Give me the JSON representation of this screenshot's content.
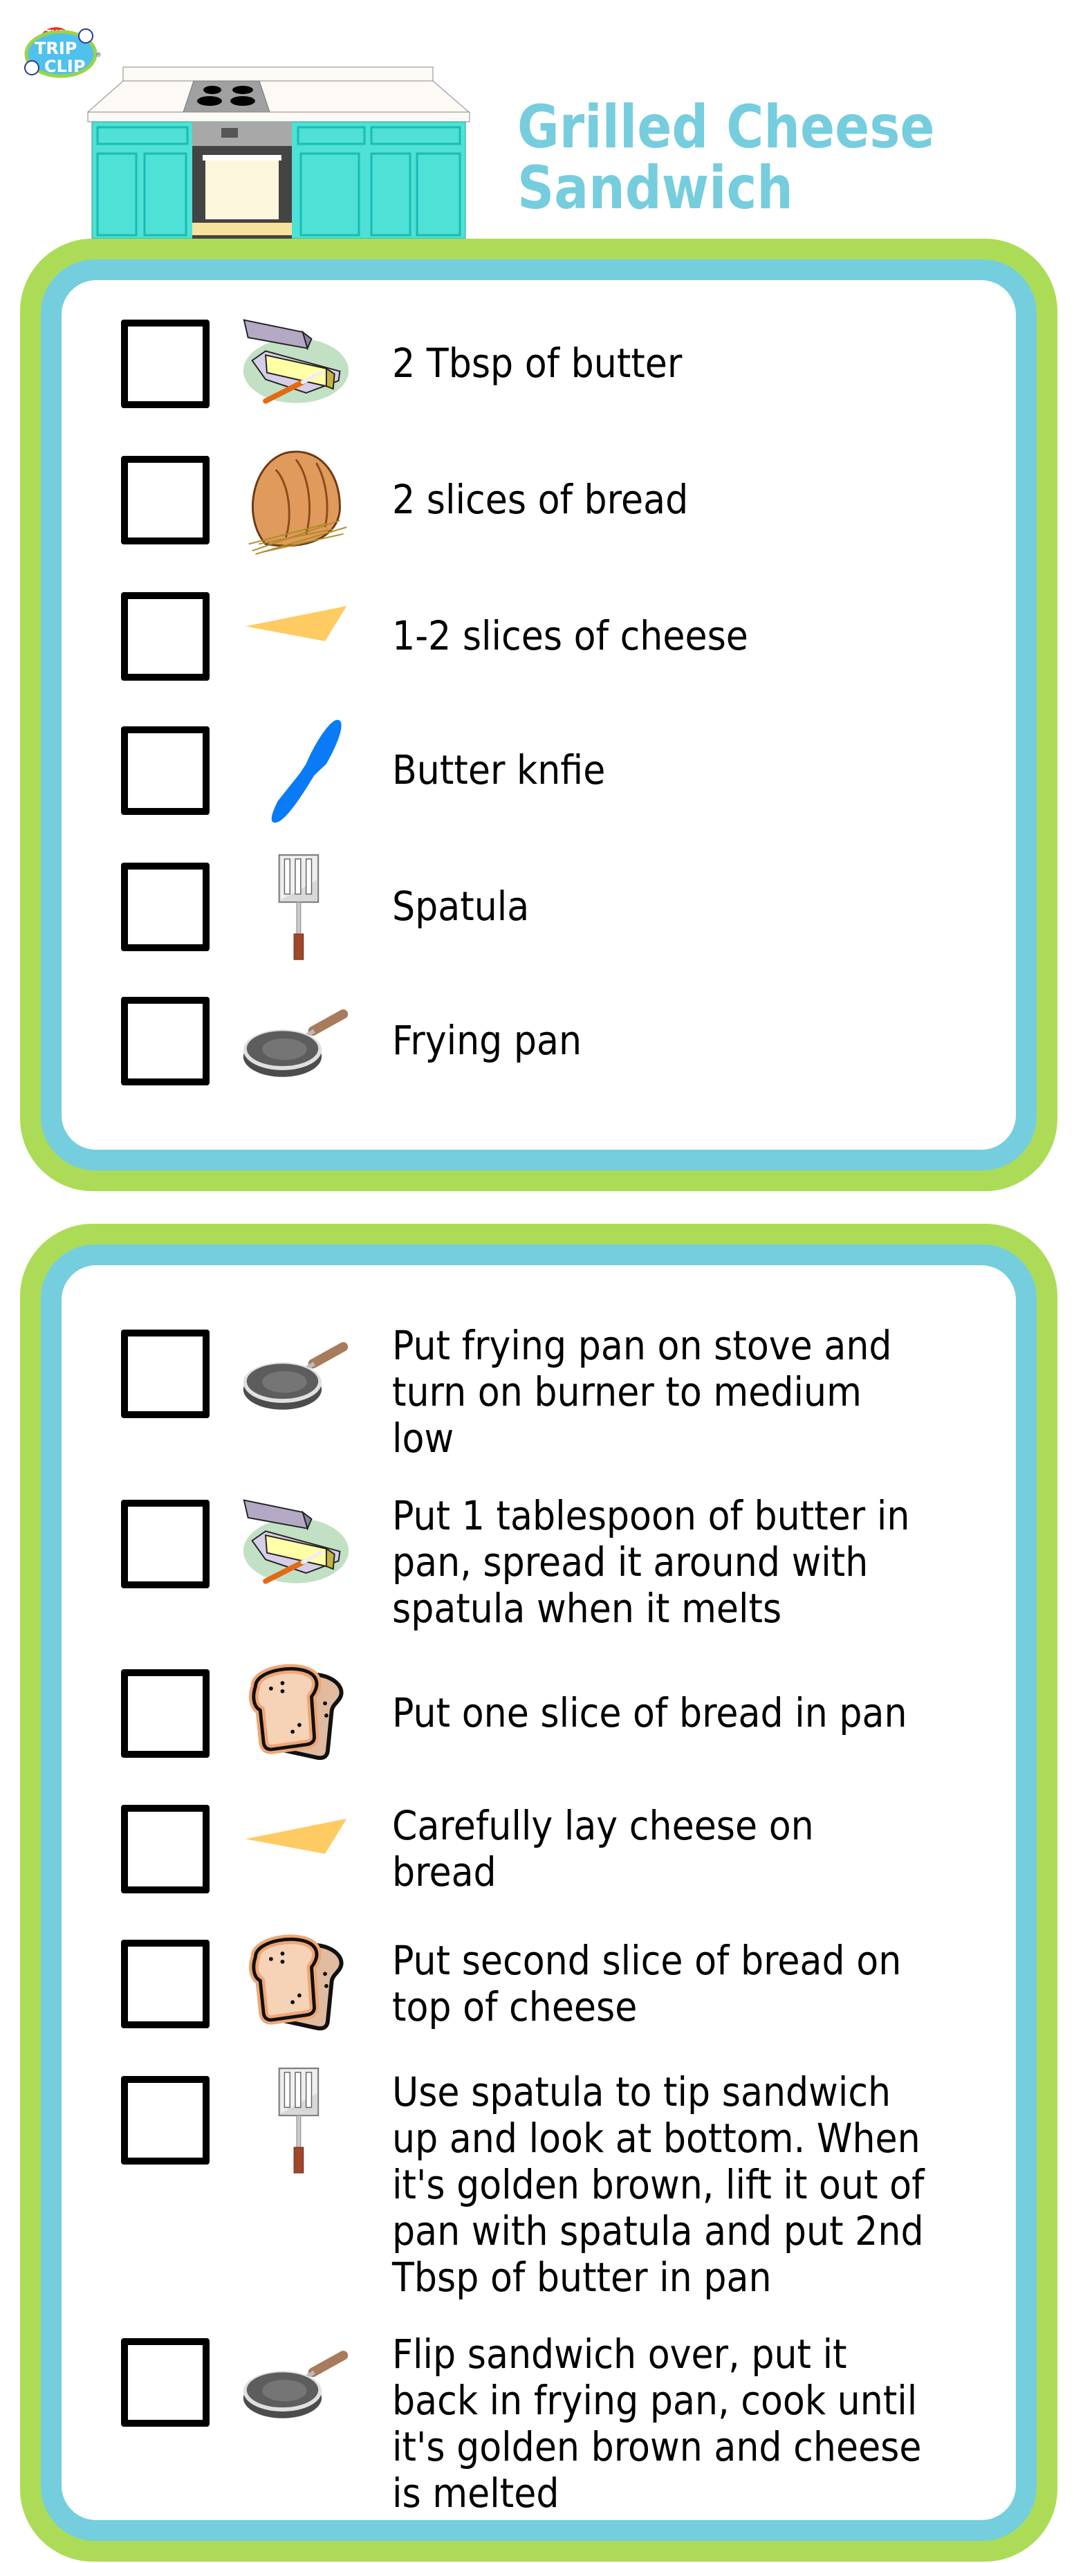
{
  "header": {
    "logo": {
      "line1": "THE",
      "line2": "TRIP",
      "line3": "CLIP",
      "registered": "®"
    },
    "title_line1": "Grilled Cheese",
    "title_line2": "Sandwich",
    "title_color": "#76cddd"
  },
  "colors": {
    "outer_border": "#acdc57",
    "inner_border": "#74cedd",
    "panel": "#ffffff"
  },
  "ingredients": {
    "items": [
      {
        "icon": "butter-dish-icon",
        "label": "2 Tbsp of butter",
        "checked": false
      },
      {
        "icon": "bread-loaf-icon",
        "label": "2 slices of bread",
        "checked": false
      },
      {
        "icon": "cheese-slice-icon",
        "label": "1-2 slices of cheese",
        "checked": false
      },
      {
        "icon": "butter-knife-icon",
        "label": "Butter knfie",
        "checked": false
      },
      {
        "icon": "spatula-icon",
        "label": "Spatula",
        "checked": false
      },
      {
        "icon": "frying-pan-icon",
        "label": "Frying pan",
        "checked": false
      }
    ]
  },
  "steps": {
    "items": [
      {
        "icon": "frying-pan-icon",
        "label": "Put frying pan on stove and\nturn on burner to medium\nlow",
        "checked": false
      },
      {
        "icon": "butter-dish-icon",
        "label": "Put 1 tablespoon of butter in\npan, spread it around with\nspatula when it melts",
        "checked": false
      },
      {
        "icon": "toast-slices-icon",
        "label": "Put one slice of bread in pan",
        "checked": false
      },
      {
        "icon": "cheese-slice-icon",
        "label": "Carefully lay cheese on\nbread",
        "checked": false
      },
      {
        "icon": "toast-slices-icon",
        "label": "Put second slice of bread on\ntop of cheese",
        "checked": false
      },
      {
        "icon": "spatula-icon",
        "label": "Use spatula to tip sandwich\nup and look at bottom. When\nit's golden brown, lift it out of\npan with spatula and put 2nd\nTbsp of butter in pan",
        "checked": false
      },
      {
        "icon": "frying-pan-icon",
        "label": "Flip sandwich over, put it\nback in frying pan, cook until\nit's golden brown and cheese\nis melted",
        "checked": false
      }
    ]
  }
}
